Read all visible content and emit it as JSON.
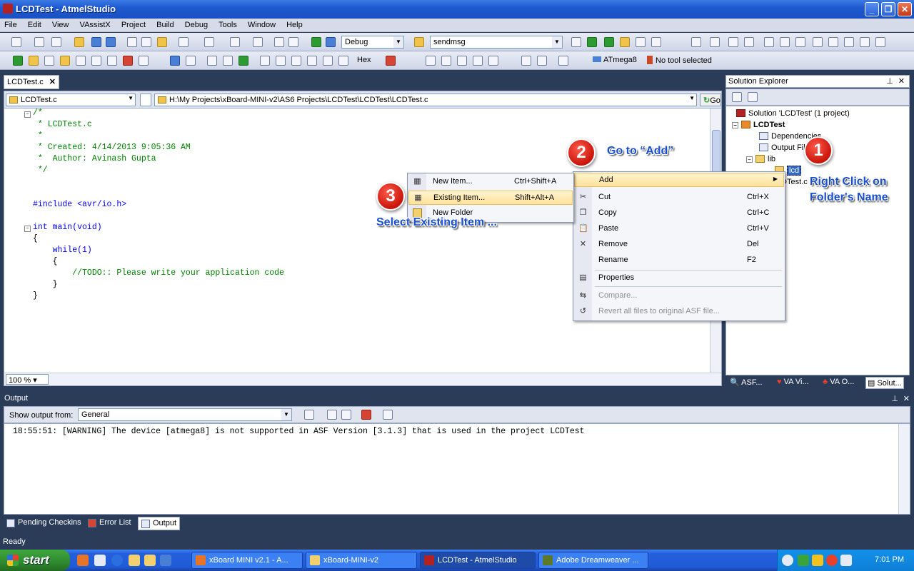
{
  "window": {
    "title": "LCDTest - AtmelStudio"
  },
  "menu": [
    "File",
    "Edit",
    "View",
    "VAssistX",
    "Project",
    "Build",
    "Debug",
    "Tools",
    "Window",
    "Help"
  ],
  "toolbar": {
    "config": "Debug",
    "search": "sendmsg",
    "hex_label": "Hex",
    "device": "ATmega8",
    "tool": "No tool selected"
  },
  "editor": {
    "tab_label": "LCDTest.c",
    "nav_file": "LCDTest.c",
    "nav_path": "H:\\My Projects\\xBoard-MINI-v2\\AS6 Projects\\LCDTest\\LCDTest\\LCDTest.c",
    "go_label": "Go",
    "zoom": "100 %",
    "lines": [
      "/*",
      " * LCDTest.c",
      " *",
      " * Created: 4/14/2013 9:05:36 AM",
      " *  Author: Avinash Gupta",
      " */",
      "",
      "",
      "#include <avr/io.h>",
      "",
      "int main(void)",
      "{",
      "    while(1)",
      "    {",
      "        //TODO:: Please write your application code",
      "    }",
      "}"
    ]
  },
  "solution_explorer": {
    "title": "Solution Explorer",
    "solution": "Solution 'LCDTest' (1 project)",
    "project": "LCDTest",
    "items": [
      "Dependencies",
      "Output Files",
      "lib",
      "lcd",
      "LCDTest.c"
    ],
    "tabs": [
      "ASF...",
      "VA Vi...",
      "VA O...",
      "Solut..."
    ]
  },
  "context_menu": {
    "items": [
      {
        "label": "Add",
        "shortcut": ""
      },
      {
        "label": "Cut",
        "shortcut": "Ctrl+X"
      },
      {
        "label": "Copy",
        "shortcut": "Ctrl+C"
      },
      {
        "label": "Paste",
        "shortcut": "Ctrl+V"
      },
      {
        "label": "Remove",
        "shortcut": "Del"
      },
      {
        "label": "Rename",
        "shortcut": "F2"
      },
      {
        "label": "Properties",
        "shortcut": ""
      },
      {
        "label": "Compare...",
        "shortcut": ""
      },
      {
        "label": "Revert all files to original ASF file...",
        "shortcut": ""
      }
    ]
  },
  "submenu": {
    "items": [
      {
        "label": "New Item...",
        "shortcut": "Ctrl+Shift+A"
      },
      {
        "label": "Existing Item...",
        "shortcut": "Shift+Alt+A"
      },
      {
        "label": "New Folder",
        "shortcut": ""
      }
    ]
  },
  "annotations": {
    "step1": "1",
    "step1_text_a": "Right Click on",
    "step1_text_b": "Folder's Name",
    "step2": "2",
    "step2_text": "Go to “Add”",
    "step3": "3",
    "step3_text": "Select Existing Item ..."
  },
  "output": {
    "title": "Output",
    "show_from_label": "Show output from:",
    "source": "General",
    "message": "18:55:51: [WARNING] The device [atmega8] is not supported in ASF Version [3.1.3] that is used in the project LCDTest",
    "tabs": [
      "Pending Checkins",
      "Error List",
      "Output"
    ]
  },
  "status": {
    "text": "Ready"
  },
  "taskbar": {
    "start": "start",
    "tasks": [
      "xBoard MINI v2.1 - A...",
      "xBoard-MINI-v2",
      "LCDTest - AtmelStudio",
      "Adobe Dreamweaver ..."
    ],
    "clock": "7:01 PM"
  },
  "colors": {
    "accent": "#1a4fd0",
    "badge": "#d4150a",
    "highlight": "#ffe29a"
  }
}
